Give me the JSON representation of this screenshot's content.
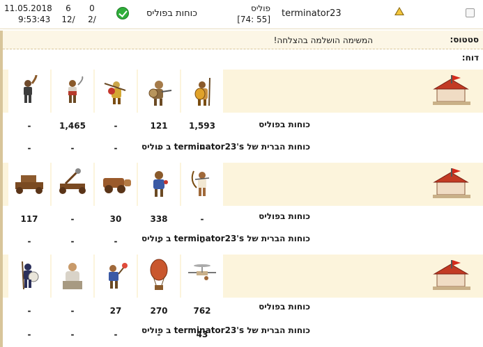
{
  "header": {
    "date": "11.05.2018",
    "time": "9:53:43",
    "col1_top": "6",
    "col1_bottom": "/12",
    "col2_top": "0",
    "col2_bottom": "/2",
    "title": "כוחות בפוליס",
    "place_name": "פוליס",
    "place_coords": "[74: 55]",
    "username": "terminator23"
  },
  "status": {
    "label": "סטטוס:",
    "value": "המשימה הושלמה בהצלחה!"
  },
  "report_label": "דוח:",
  "blocks": [
    {
      "units": [
        "hoplite-icon",
        "archer-icon",
        "slinger-icon",
        "cavalry-icon",
        "swordsman-icon"
      ],
      "row1_label": "כוחות בפוליס",
      "row1_values": [
        "1,593",
        "121",
        "-",
        "1,465",
        "-"
      ],
      "row2_label": "כוחות הברית של terminator23's ב פוליס",
      "row2_values": [
        "-",
        "-",
        "-",
        "-",
        "-"
      ]
    },
    {
      "units": [
        "archer-unit-icon",
        "slinger-unit-icon",
        "chariot-icon",
        "catapult-icon",
        "ballista-icon"
      ],
      "row1_label": "כוחות בפוליס",
      "row1_values": [
        "-",
        "338",
        "30",
        "-",
        "117"
      ],
      "row2_label": "כוחות הברית של terminator23's ב פוליס",
      "row2_values": [
        "-",
        "-",
        "-",
        "-",
        "-"
      ]
    },
    {
      "units": [
        "flying-machine-icon",
        "balloon-icon",
        "torch-bearer-icon",
        "philosopher-icon",
        "spartan-icon"
      ],
      "row1_label": "כוחות בפוליס",
      "row1_values": [
        "762",
        "270",
        "27",
        "-",
        "-"
      ],
      "row2_label": "כוחות הברית של terminator23's ב פוליס",
      "row2_values": [
        "43",
        "-",
        "-",
        "-",
        "-"
      ]
    }
  ]
}
